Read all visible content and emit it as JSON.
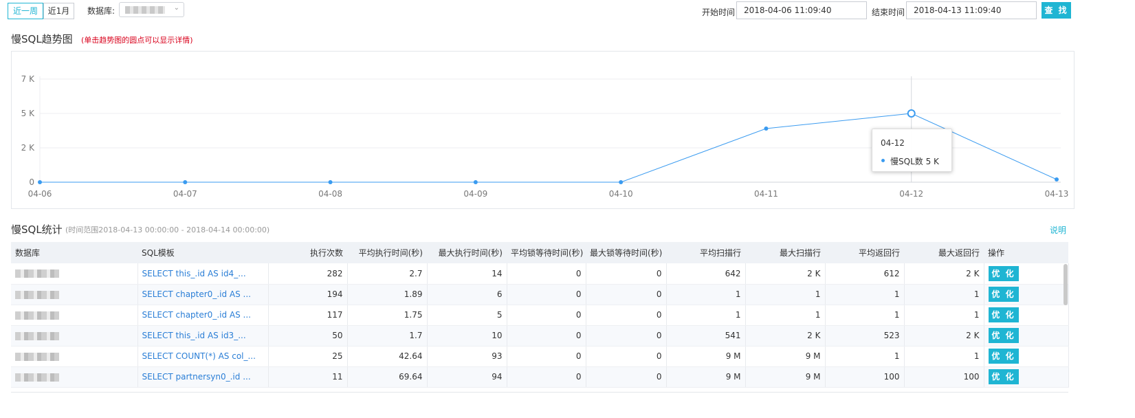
{
  "toolbar": {
    "tab_week": "近一周",
    "tab_month": "近1月",
    "db_label": "数据库:",
    "start_label": "开始时间",
    "start_value": "2018-04-06 11:09:40",
    "end_label": "结束时间",
    "end_value": "2018-04-13 11:09:40",
    "search_label": "查 找"
  },
  "trend": {
    "title": "慢SQL趋势图",
    "hint": "(单击趋势图的圆点可以显示详情)"
  },
  "chart_data": {
    "type": "line",
    "x": [
      "04-06",
      "04-07",
      "04-08",
      "04-09",
      "04-10",
      "04-11",
      "04-12",
      "04-13"
    ],
    "series": [
      {
        "values": [
          0,
          0,
          0,
          0,
          0,
          3900,
          5000,
          200
        ]
      }
    ],
    "y_ticks": [
      "0",
      "2 K",
      "5 K",
      "7 K"
    ],
    "ylim": [
      0,
      7500
    ],
    "grid": true,
    "highlight_index": 6,
    "line_color": "#3a9bf0"
  },
  "tooltip": {
    "date": "04-12",
    "value": "慢SQL数 5 K"
  },
  "stats": {
    "title": "慢SQL统计",
    "range": "(时间范围2018-04-13 00:00:00 - 2018-04-14 00:00:00)",
    "explain": "说明",
    "columns": [
      "数据库",
      "SQL模板",
      "执行次数",
      "平均执行时间(秒)",
      "最大执行时间(秒)",
      "平均锁等待时间(秒)",
      "最大锁等待时间(秒)",
      "平均扫描行",
      "最大扫描行",
      "平均返回行",
      "最大返回行",
      "操作"
    ],
    "optimize_label": "优 化",
    "rows": [
      {
        "sql": "SELECT this_.id AS id4_...",
        "exec": "282",
        "avg_time": "2.7",
        "max_time": "14",
        "avg_lock": "0",
        "max_lock": "0",
        "avg_scan": "642",
        "max_scan": "2 K",
        "avg_ret": "612",
        "max_ret": "2 K"
      },
      {
        "sql": "SELECT chapter0_.id AS ...",
        "exec": "194",
        "avg_time": "1.89",
        "max_time": "6",
        "avg_lock": "0",
        "max_lock": "0",
        "avg_scan": "1",
        "max_scan": "1",
        "avg_ret": "1",
        "max_ret": "1"
      },
      {
        "sql": "SELECT chapter0_.id AS ...",
        "exec": "117",
        "avg_time": "1.75",
        "max_time": "5",
        "avg_lock": "0",
        "max_lock": "0",
        "avg_scan": "1",
        "max_scan": "1",
        "avg_ret": "1",
        "max_ret": "1"
      },
      {
        "sql": "SELECT this_.id AS id3_...",
        "exec": "50",
        "avg_time": "1.7",
        "max_time": "10",
        "avg_lock": "0",
        "max_lock": "0",
        "avg_scan": "541",
        "max_scan": "2 K",
        "avg_ret": "523",
        "max_ret": "2 K"
      },
      {
        "sql": "SELECT COUNT(*) AS col_...",
        "exec": "25",
        "avg_time": "42.64",
        "max_time": "93",
        "avg_lock": "0",
        "max_lock": "0",
        "avg_scan": "9 M",
        "max_scan": "9 M",
        "avg_ret": "1",
        "max_ret": "1"
      },
      {
        "sql": "SELECT partnersyn0_.id ...",
        "exec": "11",
        "avg_time": "69.64",
        "max_time": "94",
        "avg_lock": "0",
        "max_lock": "0",
        "avg_scan": "9 M",
        "max_scan": "9 M",
        "avg_ret": "100",
        "max_ret": "100"
      }
    ]
  }
}
